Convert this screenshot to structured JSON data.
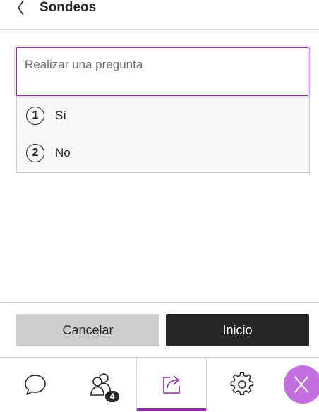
{
  "header": {
    "title": "Sondeos",
    "back_icon": "chevron-left-icon"
  },
  "poll": {
    "question_placeholder": "Realizar una pregunta",
    "question_value": "",
    "options": [
      {
        "number": "1",
        "label": "Sí"
      },
      {
        "number": "2",
        "label": "No"
      }
    ]
  },
  "actions": {
    "cancel_label": "Cancelar",
    "start_label": "Inicio"
  },
  "tabs": [
    {
      "name": "chat",
      "icon": "chat-bubble-icon"
    },
    {
      "name": "attendees",
      "icon": "people-icon",
      "badge": "4"
    },
    {
      "name": "share-content",
      "icon": "share-icon",
      "active": true
    },
    {
      "name": "settings",
      "icon": "gear-icon"
    }
  ],
  "close_icon": "close-icon",
  "colors": {
    "accent": "#8a2ea6",
    "fab": "#c46fe0",
    "primary_button": "#262626",
    "secondary_button": "#cdcdcd"
  }
}
